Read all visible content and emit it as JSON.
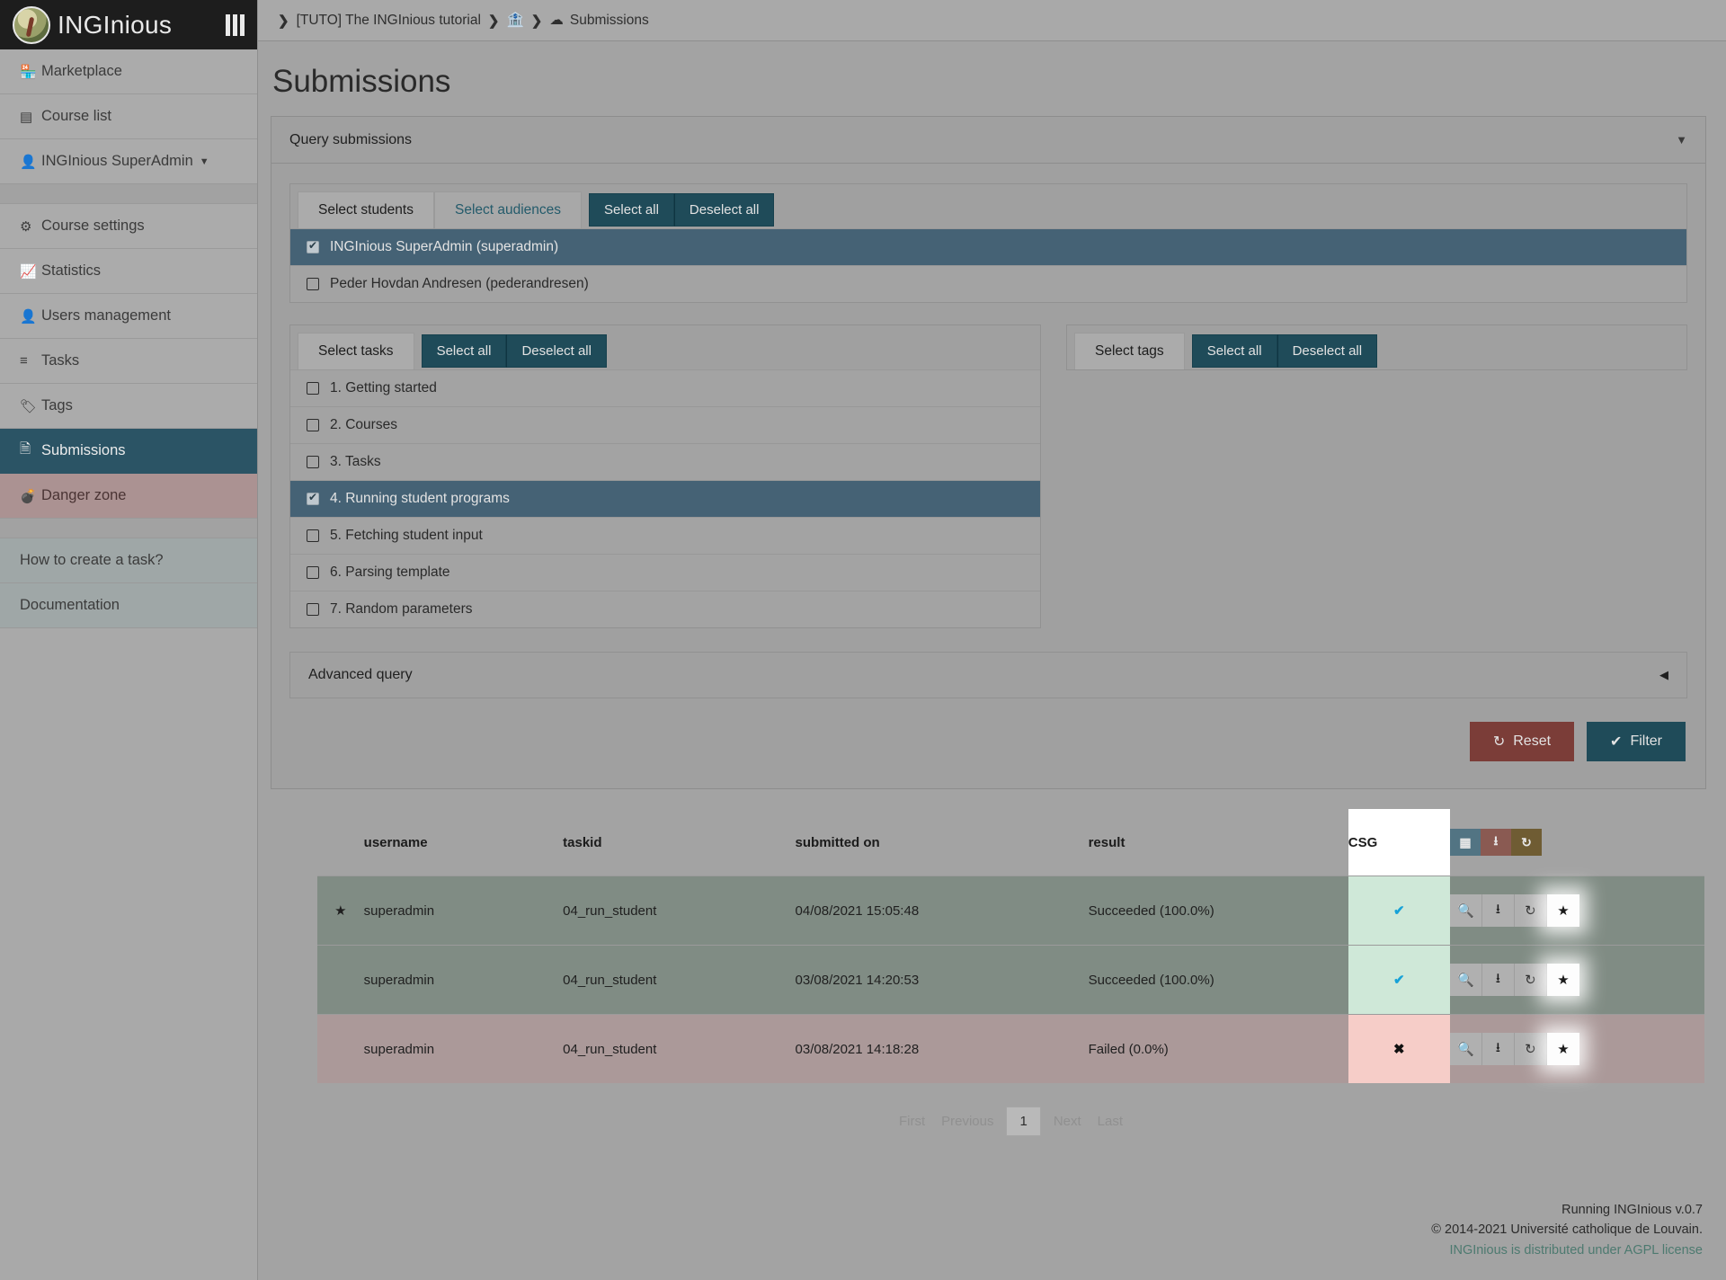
{
  "brand": {
    "title": "INGInious",
    "menu_icon": "hamburger-bars-icon"
  },
  "sidebar": {
    "items": [
      {
        "label": "Marketplace",
        "icon": "store-icon",
        "state": "normal"
      },
      {
        "label": "Course list",
        "icon": "list-icon",
        "state": "normal"
      },
      {
        "label": "INGInious SuperAdmin",
        "icon": "user-icon",
        "state": "dropdown"
      }
    ],
    "course_items": [
      {
        "label": "Course settings",
        "icon": "gear-icon",
        "state": "normal"
      },
      {
        "label": "Statistics",
        "icon": "chart-icon",
        "state": "normal"
      },
      {
        "label": "Users management",
        "icon": "user-icon",
        "state": "normal"
      },
      {
        "label": "Tasks",
        "icon": "tasks-icon",
        "state": "normal"
      },
      {
        "label": "Tags",
        "icon": "tag-icon",
        "state": "normal"
      },
      {
        "label": "Submissions",
        "icon": "submissions-icon",
        "state": "active"
      },
      {
        "label": "Danger zone",
        "icon": "bomb-icon",
        "state": "danger"
      }
    ],
    "help_items": [
      {
        "label": "How to create a task?"
      },
      {
        "label": "Documentation"
      }
    ]
  },
  "breadcrumb": {
    "course": "[TUTO] The INGInious tutorial",
    "course_icon": "bank-icon",
    "page": "Submissions",
    "page_icon": "cloud-download-icon",
    "separator": "❯"
  },
  "page": {
    "title": "Submissions"
  },
  "query_card": {
    "title": "Query submissions",
    "collapse_icon": "chevron-down-icon"
  },
  "students_panel": {
    "tabs": [
      {
        "label": "Select students",
        "active": true
      },
      {
        "label": "Select audiences",
        "active": false
      }
    ],
    "select_all": "Select all",
    "deselect_all": "Deselect all",
    "rows": [
      {
        "label": "INGInious SuperAdmin (superadmin)",
        "checked": true
      },
      {
        "label": "Peder Hovdan Andresen (pederandresen)",
        "checked": false
      }
    ]
  },
  "tasks_panel": {
    "tab": "Select tasks",
    "select_all": "Select all",
    "deselect_all": "Deselect all",
    "rows": [
      {
        "label": "1. Getting started",
        "checked": false
      },
      {
        "label": "2. Courses",
        "checked": false
      },
      {
        "label": "3. Tasks",
        "checked": false
      },
      {
        "label": "4. Running student programs",
        "checked": true
      },
      {
        "label": "5. Fetching student input",
        "checked": false
      },
      {
        "label": "6. Parsing template",
        "checked": false
      },
      {
        "label": "7. Random parameters",
        "checked": false
      }
    ]
  },
  "tags_panel": {
    "tab": "Select tags",
    "select_all": "Select all",
    "deselect_all": "Deselect all",
    "rows": []
  },
  "advanced_query": {
    "title": "Advanced query",
    "collapse_icon": "chevron-left-icon"
  },
  "actions": {
    "reset": "Reset",
    "reset_icon": "undo-icon",
    "filter": "Filter",
    "filter_icon": "check-icon"
  },
  "results": {
    "columns": [
      "username",
      "taskid",
      "submitted on",
      "result",
      "CSG"
    ],
    "toolbar": [
      {
        "icon": "table-icon",
        "name": "toggle-table-button"
      },
      {
        "icon": "download-icon",
        "name": "download-all-button"
      },
      {
        "icon": "refresh-icon",
        "name": "replay-all-button"
      }
    ],
    "row_actions": [
      {
        "icon": "search-icon",
        "name": "view-submission-button"
      },
      {
        "icon": "download-icon",
        "name": "download-submission-button"
      },
      {
        "icon": "refresh-icon",
        "name": "replay-submission-button"
      },
      {
        "icon": "star-icon",
        "name": "set-best-submission-button"
      }
    ],
    "rows": [
      {
        "starred": true,
        "username": "superadmin",
        "taskid": "04_run_student",
        "submitted_on": "04/08/2021 15:05:48",
        "result": "Succeeded (100.0%)",
        "csg": "✔",
        "status": "ok"
      },
      {
        "starred": false,
        "username": "superadmin",
        "taskid": "04_run_student",
        "submitted_on": "03/08/2021 14:20:53",
        "result": "Succeeded (100.0%)",
        "csg": "✔",
        "status": "ok"
      },
      {
        "starred": false,
        "username": "superadmin",
        "taskid": "04_run_student",
        "submitted_on": "03/08/2021 14:18:28",
        "result": "Failed (0.0%)",
        "csg": "✖",
        "status": "bad"
      }
    ]
  },
  "pagination": {
    "first": "First",
    "previous": "Previous",
    "current": "1",
    "next": "Next",
    "last": "Last"
  },
  "footer": {
    "version": "Running INGInious v.0.7",
    "copyright": "© 2014-2021 Université catholique de Louvain.",
    "license": "INGInious is distributed under AGPL license"
  },
  "colors": {
    "teal": "#1f4b59",
    "danger": "#7b3d38",
    "selected_row": "#456275",
    "success_bg": "#cfe8d8",
    "fail_bg": "#f6cdc8"
  }
}
